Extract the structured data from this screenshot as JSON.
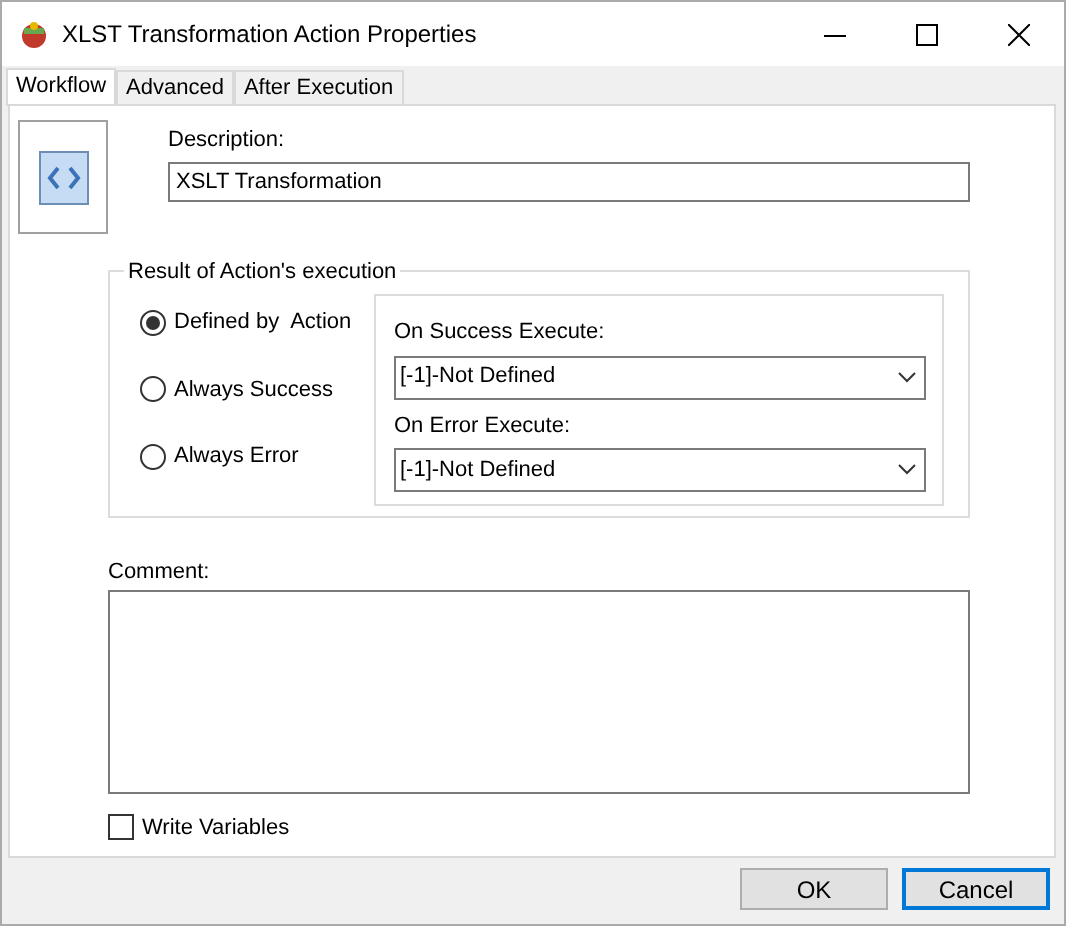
{
  "window": {
    "title": "XLST Transformation Action Properties"
  },
  "tabs": [
    {
      "label": "Workflow",
      "selected": true
    },
    {
      "label": "Advanced",
      "selected": false
    },
    {
      "label": "After Execution",
      "selected": false
    }
  ],
  "description": {
    "label": "Description:",
    "value": "XSLT Transformation"
  },
  "result_group": {
    "title": "Result of Action's execution",
    "options": [
      {
        "label": "Defined by  Action",
        "selected": true
      },
      {
        "label": "Always Success",
        "selected": false
      },
      {
        "label": "Always Error",
        "selected": false
      }
    ],
    "on_success": {
      "label": "On Success Execute:",
      "value": "[-1]-Not Defined"
    },
    "on_error": {
      "label": "On Error Execute:",
      "value": "[-1]-Not Defined"
    }
  },
  "comment": {
    "label": "Comment:"
  },
  "write_variables": {
    "label": "Write Variables",
    "checked": false
  },
  "buttons": [
    {
      "label": "OK",
      "focused": false
    },
    {
      "label": "Cancel",
      "focused": true
    }
  ]
}
